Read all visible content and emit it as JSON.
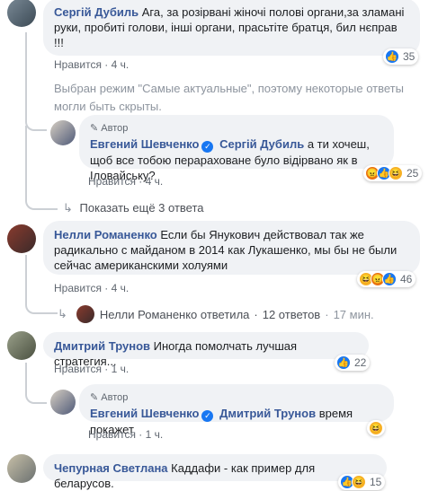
{
  "comments": [
    {
      "author": "Сергій Дубиль",
      "text": "Ага, за розірвані жіночі полові органи,за зламані руки, пробиті голови, інші органи, прасьтіте братця, бил нєправ !!!",
      "like_label": "Нравится",
      "time": "4 ч.",
      "reaction_count": "35"
    },
    {
      "notice": "Выбран режим \"Самые актуальные\", поэтому некоторые ответы могли быть скрыты."
    },
    {
      "badge": "Автор",
      "author": "Евгений Шевченко",
      "mention": "Сергій Дубиль",
      "text": "а ти хочеш, щоб все тобою перараховане було відірвано як в Іловайську?",
      "like_label": "Нравится",
      "time": "4 ч.",
      "reaction_count": "25"
    },
    {
      "more_replies": "Показать ещё 3 ответа"
    },
    {
      "author": "Нелли Романенко",
      "text": "Если бы Янукович действовал так же радикально с майданом в 2014 как Лукашенко, мы бы не были сейчас американскими холуями",
      "like_label": "Нравится",
      "time": "4 ч.",
      "reaction_count": "46",
      "replies_summary": {
        "who": "Нелли Романенко ответила",
        "count": "12 ответов",
        "age": "17 мин."
      }
    },
    {
      "author": "Дмитрий Трунов",
      "text": "Иногда помолчать лучшая стратегия...",
      "like_label": "Нравится",
      "time": "1 ч.",
      "reaction_count": "22"
    },
    {
      "badge": "Автор",
      "author": "Евгений Шевченко",
      "mention": "Дмитрий Трунов",
      "text": "время покажет",
      "like_label": "Нравится",
      "time": "1 ч."
    },
    {
      "author": "Чепурная Светлана",
      "text": "Каддафи - как пример для беларусов.",
      "reaction_count": "15"
    }
  ],
  "colors": {
    "name": "#385898",
    "bubble": "#f0f2f5",
    "meta": "#606770",
    "like": "#1877f2"
  }
}
